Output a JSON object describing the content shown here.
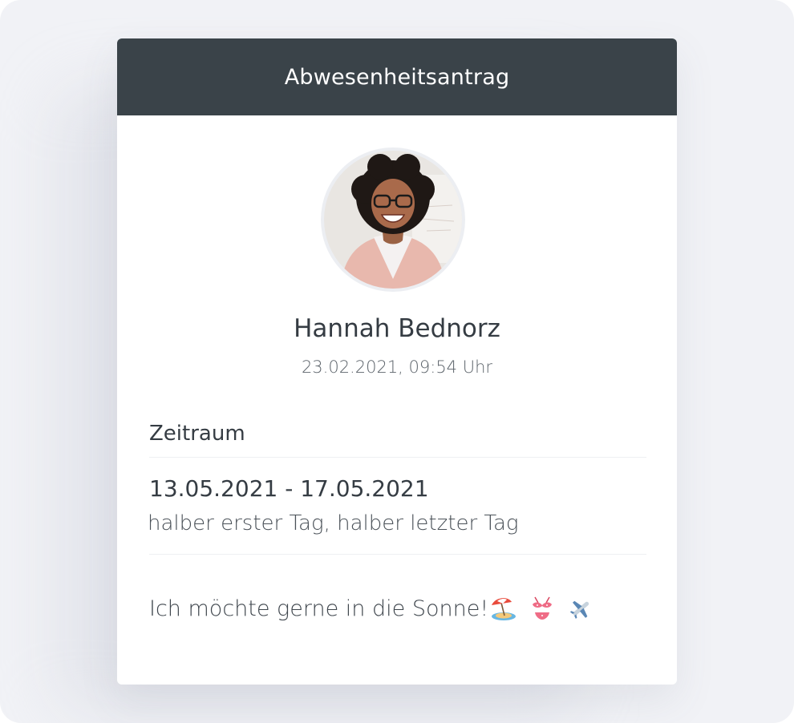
{
  "header": {
    "title": "Abwesenheitsantrag"
  },
  "requester": {
    "name": "Hannah Bednorz",
    "submitted": "23.02.2021, 09:54 Uhr"
  },
  "period": {
    "label": "Zeitraum",
    "range": "13.05.2021 - 17.05.2021",
    "note": "halber erster Tag, halber letzter Tag"
  },
  "message": {
    "text": "Ich möchte gerne in die Sonne!",
    "emojis": [
      "beach-umbrella-icon",
      "bikini-icon",
      "airplane-icon"
    ]
  },
  "colors": {
    "header_bg": "#3a4349",
    "page_bg": "#f1f2f6",
    "text_primary": "#353c43"
  }
}
